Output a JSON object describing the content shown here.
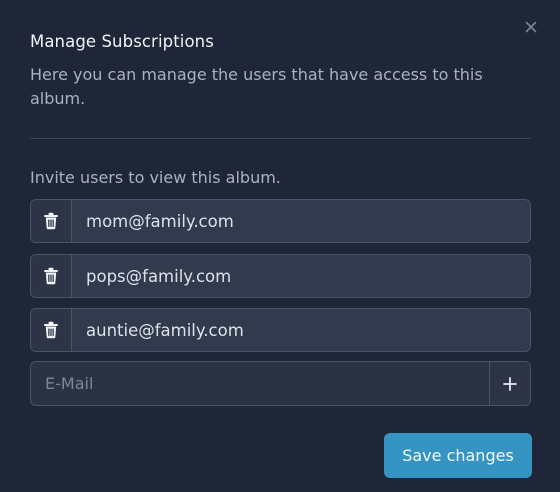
{
  "dialog": {
    "title": "Manage Subscriptions",
    "description": "Here you can manage the users that have access to this album.",
    "invite_label": "Invite users to view this album.",
    "subscribers": [
      {
        "email": "mom@family.com"
      },
      {
        "email": "pops@family.com"
      },
      {
        "email": "auntie@family.com"
      }
    ],
    "new_email": {
      "value": "",
      "placeholder": "E-Mail"
    },
    "save_label": "Save changes",
    "icons": {
      "close": "close-icon",
      "delete": "trash-icon",
      "add": "plus-icon"
    },
    "colors": {
      "background": "#1f2637",
      "accent": "#3594c2"
    }
  }
}
